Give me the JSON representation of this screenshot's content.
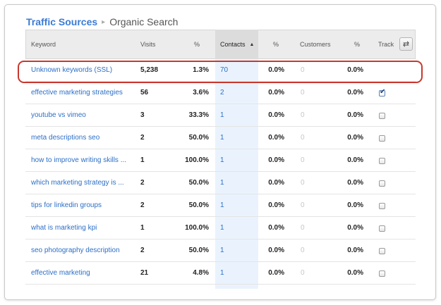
{
  "breadcrumb": {
    "parent": "Traffic Sources",
    "separator": "▸",
    "current": "Organic Search"
  },
  "table": {
    "columns": {
      "keyword": "Keyword",
      "visits": "Visits",
      "visits_pct": "%",
      "contacts": "Contacts",
      "contacts_pct": "%",
      "customers": "Customers",
      "customers_pct": "%",
      "track": "Track"
    },
    "sort_indicator": "▲",
    "toggle_icon": "⇄",
    "rows": [
      {
        "keyword": "Unknown keywords (SSL)",
        "visits": "5,238",
        "visits_pct": "1.3%",
        "contacts": "70",
        "contacts_pct": "0.0%",
        "customers": "0",
        "customers_pct": "0.0%",
        "tracked": null
      },
      {
        "keyword": "effective marketing strategies",
        "visits": "56",
        "visits_pct": "3.6%",
        "contacts": "2",
        "contacts_pct": "0.0%",
        "customers": "0",
        "customers_pct": "0.0%",
        "tracked": true
      },
      {
        "keyword": "youtube vs vimeo",
        "visits": "3",
        "visits_pct": "33.3%",
        "contacts": "1",
        "contacts_pct": "0.0%",
        "customers": "0",
        "customers_pct": "0.0%",
        "tracked": false
      },
      {
        "keyword": "meta descriptions seo",
        "visits": "2",
        "visits_pct": "50.0%",
        "contacts": "1",
        "contacts_pct": "0.0%",
        "customers": "0",
        "customers_pct": "0.0%",
        "tracked": false
      },
      {
        "keyword": "how to improve writing skills ...",
        "visits": "1",
        "visits_pct": "100.0%",
        "contacts": "1",
        "contacts_pct": "0.0%",
        "customers": "0",
        "customers_pct": "0.0%",
        "tracked": false
      },
      {
        "keyword": "which marketing strategy is ...",
        "visits": "2",
        "visits_pct": "50.0%",
        "contacts": "1",
        "contacts_pct": "0.0%",
        "customers": "0",
        "customers_pct": "0.0%",
        "tracked": false
      },
      {
        "keyword": "tips for linkedin groups",
        "visits": "2",
        "visits_pct": "50.0%",
        "contacts": "1",
        "contacts_pct": "0.0%",
        "customers": "0",
        "customers_pct": "0.0%",
        "tracked": false
      },
      {
        "keyword": "what is marketing kpi",
        "visits": "1",
        "visits_pct": "100.0%",
        "contacts": "1",
        "contacts_pct": "0.0%",
        "customers": "0",
        "customers_pct": "0.0%",
        "tracked": false
      },
      {
        "keyword": "seo photography description",
        "visits": "2",
        "visits_pct": "50.0%",
        "contacts": "1",
        "contacts_pct": "0.0%",
        "customers": "0",
        "customers_pct": "0.0%",
        "tracked": false
      },
      {
        "keyword": "effective marketing",
        "visits": "21",
        "visits_pct": "4.8%",
        "contacts": "1",
        "contacts_pct": "0.0%",
        "customers": "0",
        "customers_pct": "0.0%",
        "tracked": false
      }
    ]
  },
  "colors": {
    "link": "#2c6fc7",
    "highlight": "#c8382e",
    "sorted_column": "#eaf3fd"
  }
}
